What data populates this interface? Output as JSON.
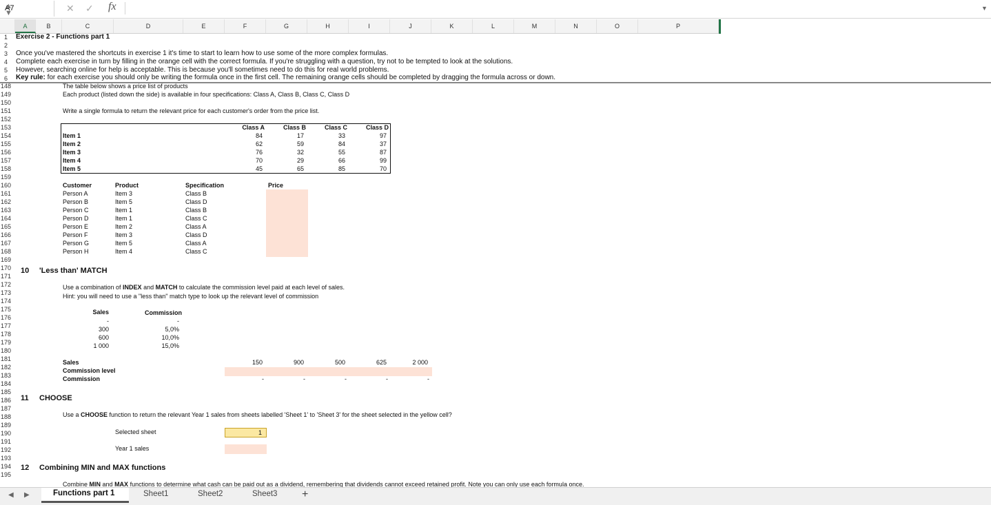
{
  "formula_bar": {
    "name_box": "A7",
    "cancel": "✕",
    "confirm": "✓",
    "fx": "fx",
    "formula": ""
  },
  "columns": [
    "A",
    "B",
    "C",
    "D",
    "E",
    "F",
    "G",
    "H",
    "I",
    "J",
    "K",
    "L",
    "M",
    "N",
    "O",
    "P"
  ],
  "rows_top": [
    "1",
    "2",
    "3",
    "4",
    "5",
    "6"
  ],
  "rows_bottom": [
    "148",
    "149",
    "150",
    "151",
    "152",
    "153",
    "154",
    "155",
    "156",
    "157",
    "158",
    "159",
    "160",
    "161",
    "162",
    "163",
    "164",
    "165",
    "166",
    "167",
    "168",
    "169",
    "170",
    "171",
    "172",
    "173",
    "174",
    "175",
    "176",
    "177",
    "178",
    "179",
    "180",
    "181",
    "182",
    "183",
    "184",
    "185",
    "186",
    "187",
    "188",
    "189",
    "190",
    "191",
    "192",
    "193",
    "194",
    "195"
  ],
  "header": {
    "title": "Exercise 2 - Functions part 1",
    "line3": "Once you've mastered the shortcuts in exercise 1 it's time to start to learn how to use some of the more complex formulas.",
    "line4": "Complete each exercise in turn by filling in the orange cell with the correct formula. If you're struggling with a question, try not to be tempted to look at the solutions.",
    "line5": "However, searching online for help is acceptable. This is because you'll sometimes need to do this for real world problems.",
    "keyrule_label": "Key rule:",
    "keyrule_text": " for each exercise you should only be writing the formula once in the first cell. The remaining orange cells should be completed by dragging the formula across or down."
  },
  "ex9": {
    "line148": "The table below shows a price list of products",
    "line149": "Each product (listed down the side) is available in four specifications: Class A, Class B, Class C, Class D",
    "line151": "Write a single formula to return the relevant price for each customer's order from the price list.",
    "price_table": {
      "classes": [
        "Class A",
        "Class B",
        "Class C",
        "Class D"
      ],
      "items": [
        {
          "name": "Item 1",
          "values": [
            "84",
            "17",
            "33",
            "97"
          ]
        },
        {
          "name": "Item 2",
          "values": [
            "62",
            "59",
            "84",
            "37"
          ]
        },
        {
          "name": "Item 3",
          "values": [
            "76",
            "32",
            "55",
            "87"
          ]
        },
        {
          "name": "Item 4",
          "values": [
            "70",
            "29",
            "66",
            "99"
          ]
        },
        {
          "name": "Item 5",
          "values": [
            "45",
            "65",
            "85",
            "70"
          ]
        }
      ]
    },
    "orders_headers": {
      "customer": "Customer",
      "product": "Product",
      "spec": "Specification",
      "price": "Price"
    },
    "orders": [
      {
        "customer": "Person A",
        "product": "Item 3",
        "spec": "Class B"
      },
      {
        "customer": "Person B",
        "product": "Item 5",
        "spec": "Class D"
      },
      {
        "customer": "Person C",
        "product": "Item 1",
        "spec": "Class B"
      },
      {
        "customer": "Person D",
        "product": "Item 1",
        "spec": "Class C"
      },
      {
        "customer": "Person E",
        "product": "Item 2",
        "spec": "Class A"
      },
      {
        "customer": "Person F",
        "product": "Item 3",
        "spec": "Class D"
      },
      {
        "customer": "Person G",
        "product": "Item 5",
        "spec": "Class A"
      },
      {
        "customer": "Person H",
        "product": "Item 4",
        "spec": "Class C"
      }
    ]
  },
  "ex10": {
    "number": "10",
    "title": "'Less than' MATCH",
    "line172_pre": "Use a combination of ",
    "line172_b1": "INDEX",
    "line172_mid": " and ",
    "line172_b2": "MATCH",
    "line172_post": " to calculate the commission level paid at each level of sales.",
    "line173": "Hint: you will need to use a \"less than\" match type to look up the relevant level of commission",
    "sales_hdr": "Sales",
    "comm_hdr": "Commission",
    "tiers": [
      {
        "sales": "-",
        "comm": "-"
      },
      {
        "sales": "300",
        "comm": "5,0%"
      },
      {
        "sales": "600",
        "comm": "10,0%"
      },
      {
        "sales": "1 000",
        "comm": "15,0%"
      }
    ],
    "sales_label": "Sales",
    "commlevel_label": "Commission level",
    "commission_label": "Commission",
    "sales_values": [
      "150",
      "900",
      "500",
      "625",
      "2 000"
    ],
    "commission_values": [
      "-",
      "-",
      "-",
      "-",
      "-"
    ]
  },
  "ex11": {
    "number": "11",
    "title": "CHOOSE",
    "line187_pre": "Use a ",
    "line187_b": "CHOOSE",
    "line187_post": " function to return the relevant Year 1 sales from sheets labelled 'Sheet 1' to 'Sheet 3' for the sheet selected in the yellow cell?",
    "selected_label": "Selected sheet",
    "selected_value": "1",
    "year1_label": "Year 1 sales"
  },
  "ex12": {
    "number": "12",
    "title": "Combining MIN and MAX functions",
    "line195_pre": "Combine ",
    "line195_b1": "MIN",
    "line195_mid": " and ",
    "line195_b2": "MAX",
    "line195_post": " functions to determine what cash can be paid out as a dividend, remembering that dividends cannot exceed retained profit. Note you can only use each formula once."
  },
  "tabs": [
    "Functions part 1",
    "Sheet1",
    "Sheet2",
    "Sheet3"
  ],
  "colors": {
    "orange_fill": "#fde2d6",
    "yellow_fill": "#fbe8a2",
    "excel_green": "#217346"
  }
}
